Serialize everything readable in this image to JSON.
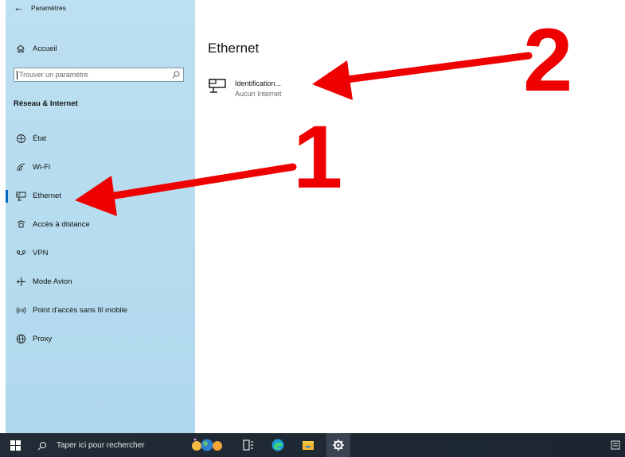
{
  "window": {
    "app_title": "Paramètres"
  },
  "sidebar": {
    "home_label": "Accueil",
    "search_placeholder": "Trouver un paramètre",
    "section_title": "Réseau & Internet",
    "items": [
      {
        "label": "État",
        "icon": "status-icon"
      },
      {
        "label": "Wi-Fi",
        "icon": "wifi-icon"
      },
      {
        "label": "Ethernet",
        "icon": "ethernet-icon",
        "selected": true
      },
      {
        "label": "Accès à distance",
        "icon": "dialup-icon"
      },
      {
        "label": "VPN",
        "icon": "vpn-icon"
      },
      {
        "label": "Mode Avion",
        "icon": "airplane-icon"
      },
      {
        "label": "Point d'accès sans fil mobile",
        "icon": "hotspot-icon"
      },
      {
        "label": "Proxy",
        "icon": "globe-icon"
      }
    ]
  },
  "content": {
    "title": "Ethernet",
    "network": {
      "name": "Identification...",
      "status": "Aucun Internet"
    }
  },
  "annotations": {
    "label_1": "1",
    "label_2": "2",
    "color": "#ee0000"
  },
  "taskbar": {
    "search_placeholder": "Taper ici pour rechercher",
    "apps": [
      "widgets-icon",
      "task-view-icon",
      "edge-icon",
      "file-explorer-icon",
      "settings-icon"
    ]
  }
}
